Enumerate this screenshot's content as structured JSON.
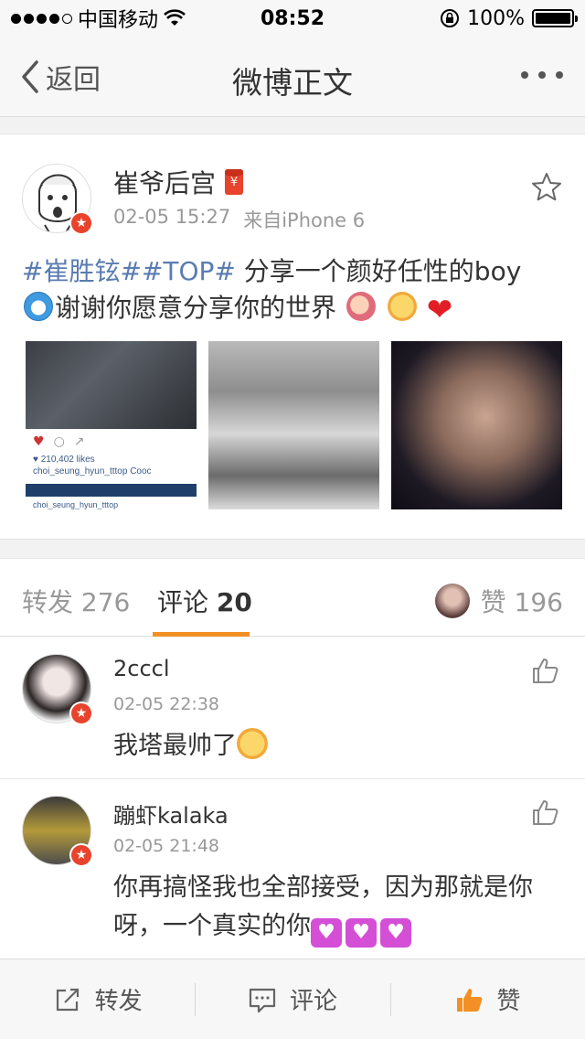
{
  "status_bar": {
    "carrier": "中国移动",
    "time": "08:52",
    "battery": "100%"
  },
  "nav": {
    "back_label": "返回",
    "title": "微博正文"
  },
  "post": {
    "author": "崔爷后宫",
    "time": "02-05 15:27",
    "source": "来自iPhone 6",
    "topic1": "#崔胜铉#",
    "topic2": "#TOP#",
    "text1": " 分享一个颜好任性的boy",
    "text2": "谢谢你愿意分享你的世界",
    "photo1_likes": "♥ 210,402 likes",
    "photo1_caption": "choi_seung_hyun_tttop Cooc",
    "photo1_user": "choi_seung_hyun_tttop"
  },
  "tabs": {
    "repost_label": "转发",
    "repost_count": "276",
    "comment_label": "评论",
    "comment_count": "20",
    "like_label": "赞",
    "like_count": "196"
  },
  "comments": [
    {
      "name": "2cccl",
      "time": "02-05 22:38",
      "text": "我塔最帅了"
    },
    {
      "name": "蹦虾kalaka",
      "time": "02-05 21:48",
      "text": "你再搞怪我也全部接受，因为那就是你呀，一个真实的你"
    }
  ],
  "toolbar": {
    "repost": "转发",
    "comment": "评论",
    "like": "赞"
  },
  "colors": {
    "accent": "#f29025",
    "topic": "#5a7cb1",
    "vip_red": "#e8432c"
  }
}
